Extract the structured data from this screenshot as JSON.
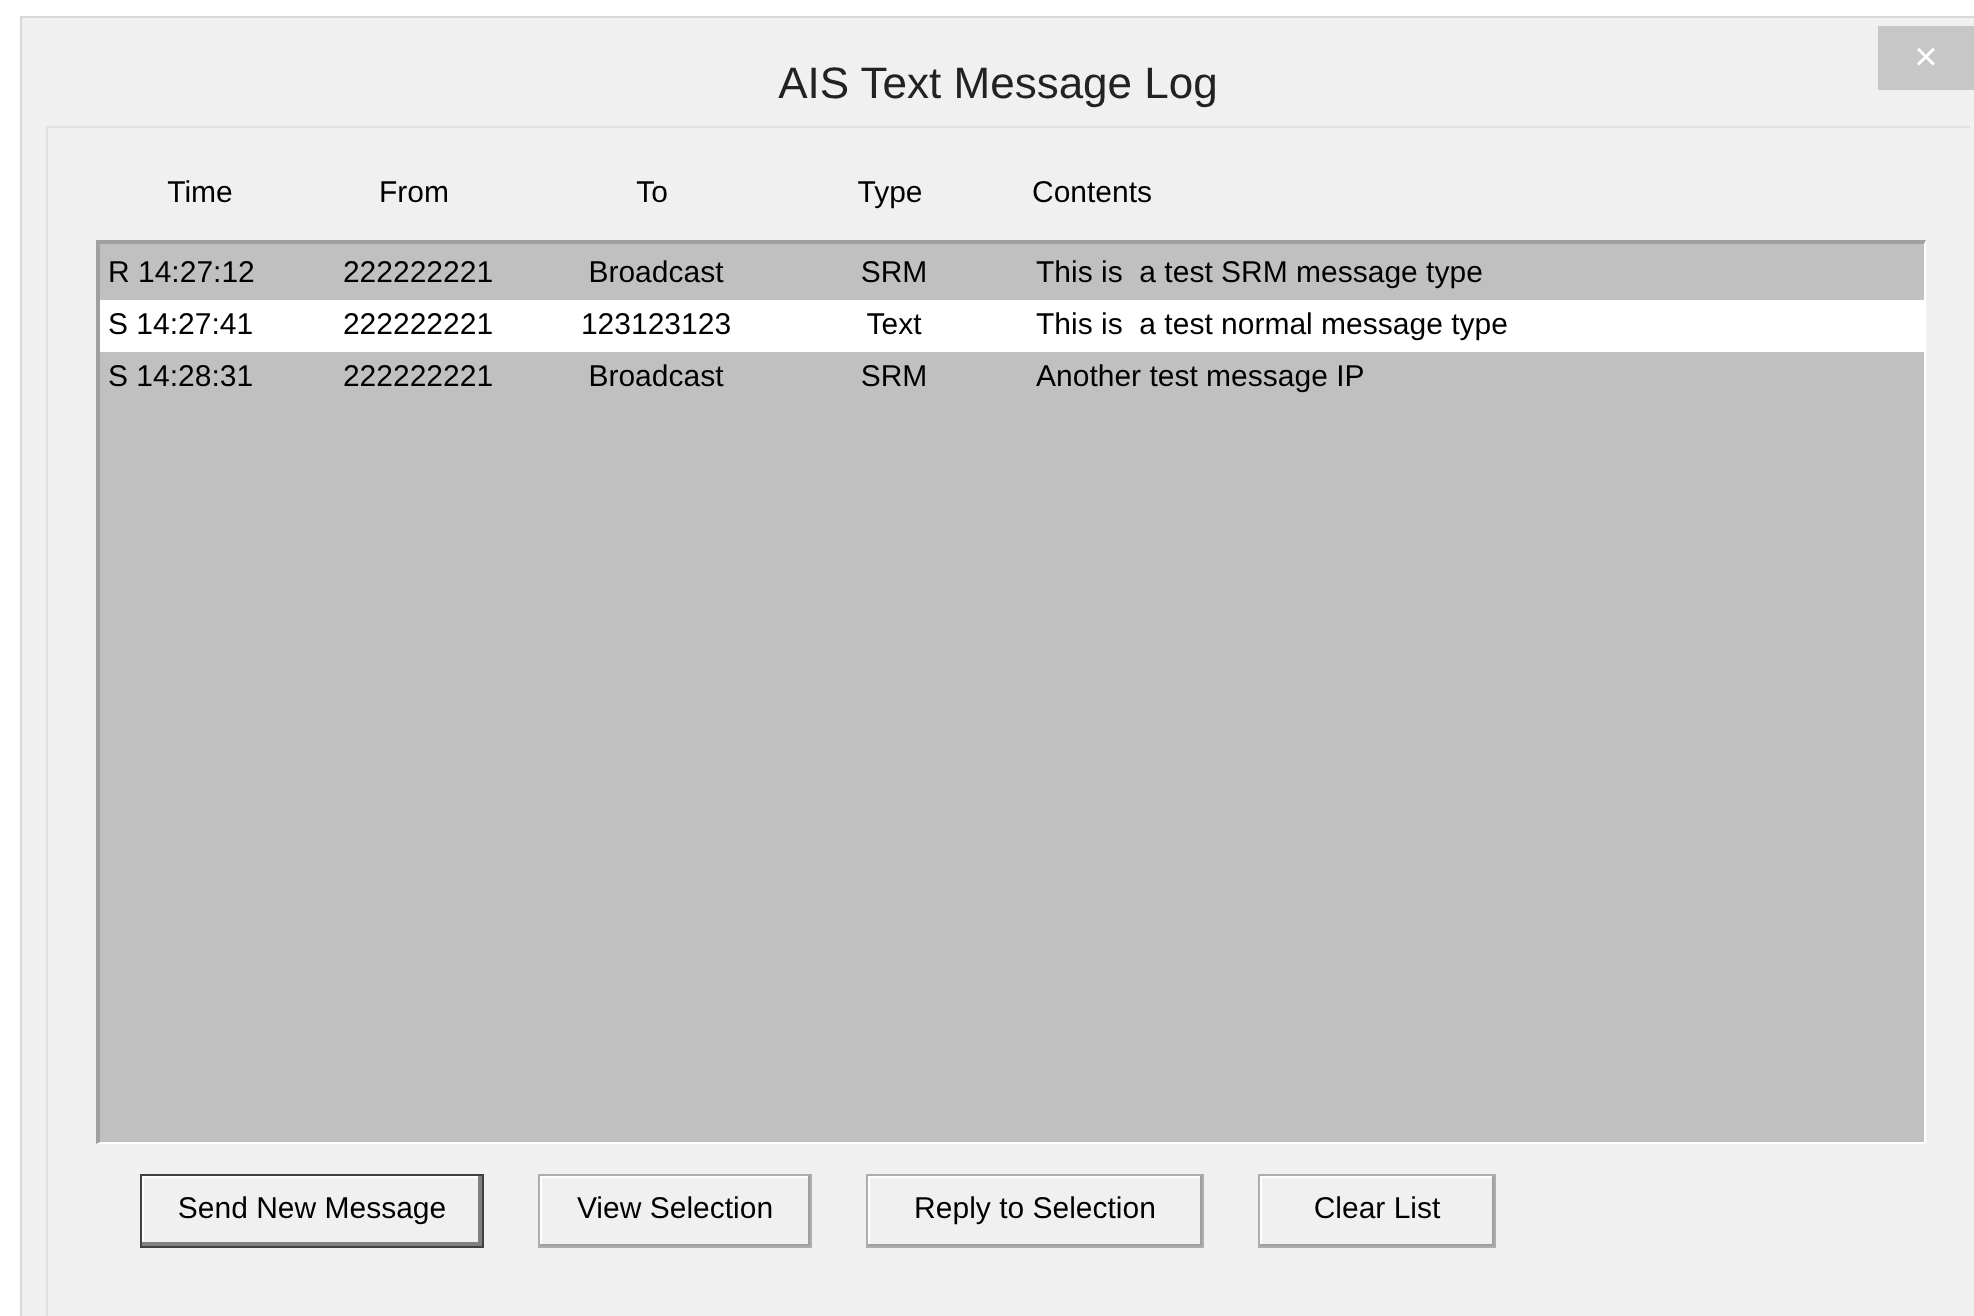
{
  "window": {
    "title": "AIS Text Message Log",
    "close": "×"
  },
  "table": {
    "columns": [
      "Time",
      "From",
      "To",
      "Type",
      "Contents"
    ],
    "rows": [
      {
        "time": "R 14:27:12",
        "from": "222222221",
        "to": "Broadcast",
        "type": "SRM",
        "contents": "This is  a test SRM message type",
        "selected": false
      },
      {
        "time": "S 14:27:41",
        "from": "222222221",
        "to": "123123123",
        "type": "Text",
        "contents": "This is  a test normal message type",
        "selected": true
      },
      {
        "time": "S 14:28:31",
        "from": "222222221",
        "to": "Broadcast",
        "type": "SRM",
        "contents": "Another test message IP",
        "selected": false
      }
    ]
  },
  "buttons": [
    {
      "label": "Send New Message",
      "default": true
    },
    {
      "label": "View Selection",
      "default": false
    },
    {
      "label": "Reply to Selection",
      "default": false
    },
    {
      "label": "Clear List",
      "default": false
    }
  ]
}
